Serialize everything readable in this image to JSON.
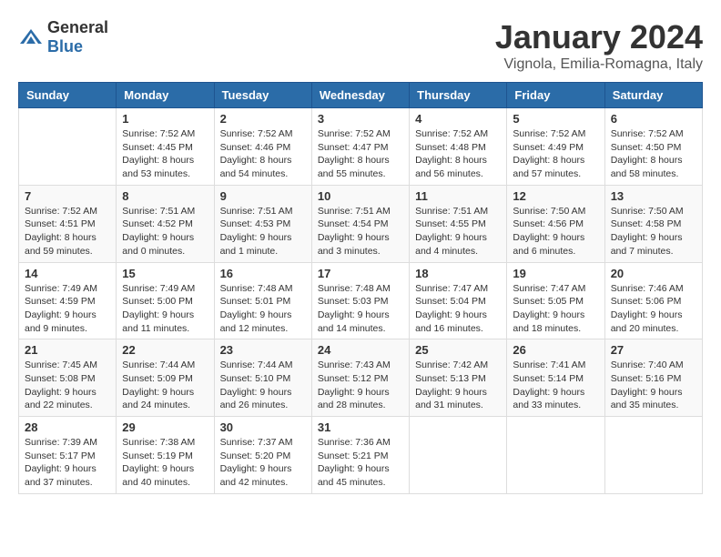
{
  "header": {
    "logo_general": "General",
    "logo_blue": "Blue",
    "month_title": "January 2024",
    "location": "Vignola, Emilia-Romagna, Italy"
  },
  "weekdays": [
    "Sunday",
    "Monday",
    "Tuesday",
    "Wednesday",
    "Thursday",
    "Friday",
    "Saturday"
  ],
  "weeks": [
    [
      {
        "day": "",
        "sunrise": "",
        "sunset": "",
        "daylight": ""
      },
      {
        "day": "1",
        "sunrise": "Sunrise: 7:52 AM",
        "sunset": "Sunset: 4:45 PM",
        "daylight": "Daylight: 8 hours and 53 minutes."
      },
      {
        "day": "2",
        "sunrise": "Sunrise: 7:52 AM",
        "sunset": "Sunset: 4:46 PM",
        "daylight": "Daylight: 8 hours and 54 minutes."
      },
      {
        "day": "3",
        "sunrise": "Sunrise: 7:52 AM",
        "sunset": "Sunset: 4:47 PM",
        "daylight": "Daylight: 8 hours and 55 minutes."
      },
      {
        "day": "4",
        "sunrise": "Sunrise: 7:52 AM",
        "sunset": "Sunset: 4:48 PM",
        "daylight": "Daylight: 8 hours and 56 minutes."
      },
      {
        "day": "5",
        "sunrise": "Sunrise: 7:52 AM",
        "sunset": "Sunset: 4:49 PM",
        "daylight": "Daylight: 8 hours and 57 minutes."
      },
      {
        "day": "6",
        "sunrise": "Sunrise: 7:52 AM",
        "sunset": "Sunset: 4:50 PM",
        "daylight": "Daylight: 8 hours and 58 minutes."
      }
    ],
    [
      {
        "day": "7",
        "sunrise": "Sunrise: 7:52 AM",
        "sunset": "Sunset: 4:51 PM",
        "daylight": "Daylight: 8 hours and 59 minutes."
      },
      {
        "day": "8",
        "sunrise": "Sunrise: 7:51 AM",
        "sunset": "Sunset: 4:52 PM",
        "daylight": "Daylight: 9 hours and 0 minutes."
      },
      {
        "day": "9",
        "sunrise": "Sunrise: 7:51 AM",
        "sunset": "Sunset: 4:53 PM",
        "daylight": "Daylight: 9 hours and 1 minute."
      },
      {
        "day": "10",
        "sunrise": "Sunrise: 7:51 AM",
        "sunset": "Sunset: 4:54 PM",
        "daylight": "Daylight: 9 hours and 3 minutes."
      },
      {
        "day": "11",
        "sunrise": "Sunrise: 7:51 AM",
        "sunset": "Sunset: 4:55 PM",
        "daylight": "Daylight: 9 hours and 4 minutes."
      },
      {
        "day": "12",
        "sunrise": "Sunrise: 7:50 AM",
        "sunset": "Sunset: 4:56 PM",
        "daylight": "Daylight: 9 hours and 6 minutes."
      },
      {
        "day": "13",
        "sunrise": "Sunrise: 7:50 AM",
        "sunset": "Sunset: 4:58 PM",
        "daylight": "Daylight: 9 hours and 7 minutes."
      }
    ],
    [
      {
        "day": "14",
        "sunrise": "Sunrise: 7:49 AM",
        "sunset": "Sunset: 4:59 PM",
        "daylight": "Daylight: 9 hours and 9 minutes."
      },
      {
        "day": "15",
        "sunrise": "Sunrise: 7:49 AM",
        "sunset": "Sunset: 5:00 PM",
        "daylight": "Daylight: 9 hours and 11 minutes."
      },
      {
        "day": "16",
        "sunrise": "Sunrise: 7:48 AM",
        "sunset": "Sunset: 5:01 PM",
        "daylight": "Daylight: 9 hours and 12 minutes."
      },
      {
        "day": "17",
        "sunrise": "Sunrise: 7:48 AM",
        "sunset": "Sunset: 5:03 PM",
        "daylight": "Daylight: 9 hours and 14 minutes."
      },
      {
        "day": "18",
        "sunrise": "Sunrise: 7:47 AM",
        "sunset": "Sunset: 5:04 PM",
        "daylight": "Daylight: 9 hours and 16 minutes."
      },
      {
        "day": "19",
        "sunrise": "Sunrise: 7:47 AM",
        "sunset": "Sunset: 5:05 PM",
        "daylight": "Daylight: 9 hours and 18 minutes."
      },
      {
        "day": "20",
        "sunrise": "Sunrise: 7:46 AM",
        "sunset": "Sunset: 5:06 PM",
        "daylight": "Daylight: 9 hours and 20 minutes."
      }
    ],
    [
      {
        "day": "21",
        "sunrise": "Sunrise: 7:45 AM",
        "sunset": "Sunset: 5:08 PM",
        "daylight": "Daylight: 9 hours and 22 minutes."
      },
      {
        "day": "22",
        "sunrise": "Sunrise: 7:44 AM",
        "sunset": "Sunset: 5:09 PM",
        "daylight": "Daylight: 9 hours and 24 minutes."
      },
      {
        "day": "23",
        "sunrise": "Sunrise: 7:44 AM",
        "sunset": "Sunset: 5:10 PM",
        "daylight": "Daylight: 9 hours and 26 minutes."
      },
      {
        "day": "24",
        "sunrise": "Sunrise: 7:43 AM",
        "sunset": "Sunset: 5:12 PM",
        "daylight": "Daylight: 9 hours and 28 minutes."
      },
      {
        "day": "25",
        "sunrise": "Sunrise: 7:42 AM",
        "sunset": "Sunset: 5:13 PM",
        "daylight": "Daylight: 9 hours and 31 minutes."
      },
      {
        "day": "26",
        "sunrise": "Sunrise: 7:41 AM",
        "sunset": "Sunset: 5:14 PM",
        "daylight": "Daylight: 9 hours and 33 minutes."
      },
      {
        "day": "27",
        "sunrise": "Sunrise: 7:40 AM",
        "sunset": "Sunset: 5:16 PM",
        "daylight": "Daylight: 9 hours and 35 minutes."
      }
    ],
    [
      {
        "day": "28",
        "sunrise": "Sunrise: 7:39 AM",
        "sunset": "Sunset: 5:17 PM",
        "daylight": "Daylight: 9 hours and 37 minutes."
      },
      {
        "day": "29",
        "sunrise": "Sunrise: 7:38 AM",
        "sunset": "Sunset: 5:19 PM",
        "daylight": "Daylight: 9 hours and 40 minutes."
      },
      {
        "day": "30",
        "sunrise": "Sunrise: 7:37 AM",
        "sunset": "Sunset: 5:20 PM",
        "daylight": "Daylight: 9 hours and 42 minutes."
      },
      {
        "day": "31",
        "sunrise": "Sunrise: 7:36 AM",
        "sunset": "Sunset: 5:21 PM",
        "daylight": "Daylight: 9 hours and 45 minutes."
      },
      {
        "day": "",
        "sunrise": "",
        "sunset": "",
        "daylight": ""
      },
      {
        "day": "",
        "sunrise": "",
        "sunset": "",
        "daylight": ""
      },
      {
        "day": "",
        "sunrise": "",
        "sunset": "",
        "daylight": ""
      }
    ]
  ]
}
